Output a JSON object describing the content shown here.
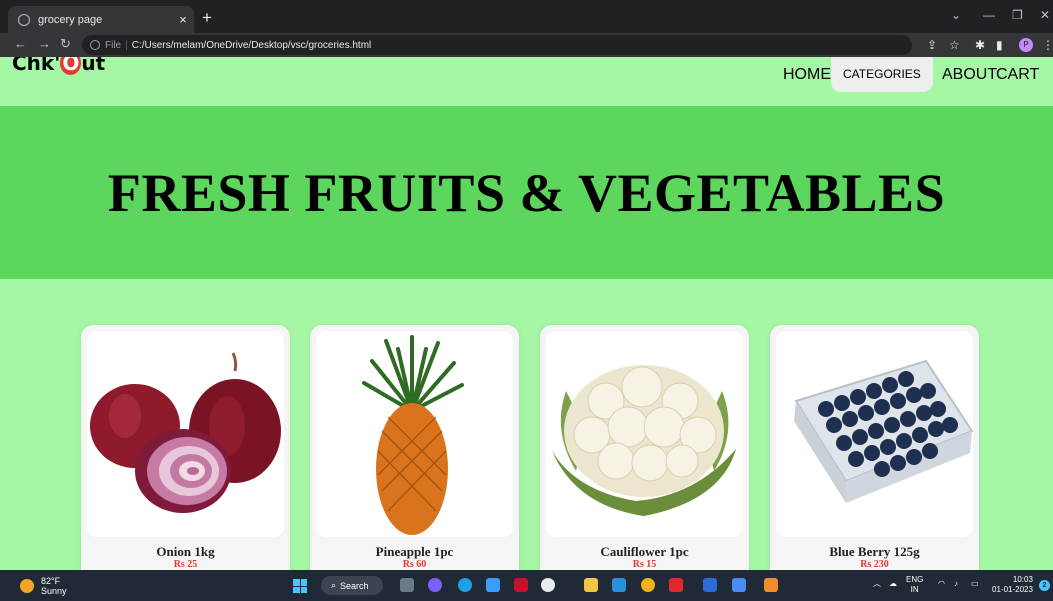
{
  "browser": {
    "tab_title": "grocery page",
    "tab_close": "×",
    "new_tab": "+",
    "address_file_label": "File",
    "address_separator": "|",
    "address_url": "C:/Users/melam/OneDrive/Desktop/vsc/groceries.html",
    "profile_initial": "P"
  },
  "site": {
    "logo": {
      "part1": "Chk'",
      "part2": "O",
      "part3": "ut"
    },
    "nav": [
      {
        "label": "HOME"
      },
      {
        "label": "CATEGORIES"
      },
      {
        "label": "ABOUT"
      },
      {
        "label": "CART"
      }
    ],
    "hero_title": "FRESH FRUITS & VEGETABLES",
    "products": [
      {
        "name": "Onion 1kg",
        "price": "Rs 25",
        "image": "onion"
      },
      {
        "name": "Pineapple 1pc",
        "price": "Rs 60",
        "image": "pineapple"
      },
      {
        "name": "Cauliflower 1pc",
        "price": "Rs 15",
        "image": "cauliflower"
      },
      {
        "name": "Blue Berry 125g",
        "price": "Rs 230",
        "image": "blueberry"
      }
    ]
  },
  "taskbar": {
    "temp": "82°F",
    "condition": "Sunny",
    "search_label": "Search",
    "lang_top": "ENG",
    "lang_bottom": "IN",
    "time": "10:03",
    "date": "01-01-2023",
    "notification_count": "2"
  },
  "colors": {
    "page_bg": "#a5f7a5",
    "hero_bg": "#5cd65c",
    "price": "#e53935"
  }
}
